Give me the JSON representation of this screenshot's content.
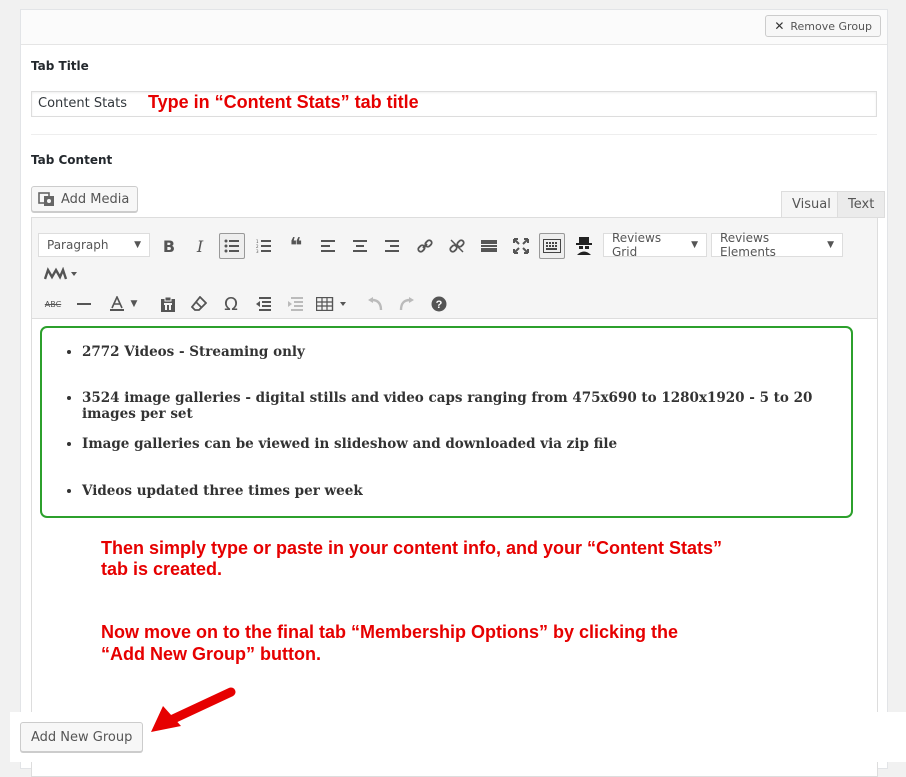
{
  "group": {
    "remove_label": "Remove Group",
    "tab_title_label": "Tab Title",
    "tab_title_value": "Content Stats",
    "tab_content_label": "Tab Content"
  },
  "editor": {
    "add_media_label": "Add Media",
    "tabs": {
      "visual": "Visual",
      "text": "Text"
    },
    "format_select": "Paragraph",
    "reviews_grid": "Reviews Grid",
    "reviews_elements": "Reviews Elements",
    "toolbar_row1_icons": [
      "bold-icon",
      "italic-icon",
      "bullet-list-icon",
      "numbered-list-icon",
      "blockquote-icon",
      "align-left-icon",
      "align-center-icon",
      "align-right-icon",
      "link-icon",
      "unlink-icon",
      "read-more-icon",
      "fullscreen-icon",
      "toolbar-toggle-icon",
      "spy-icon"
    ],
    "toolbar_row2_icons": [
      "strikethrough-icon",
      "horizontal-line-icon",
      "text-color-icon",
      "paste-text-icon",
      "clear-formatting-icon",
      "special-character-icon",
      "outdent-icon",
      "indent-icon",
      "table-icon",
      "undo-icon",
      "redo-icon",
      "help-icon"
    ],
    "content_items": [
      "2772 Videos - Streaming only",
      "3524 image galleries - digital stills and video caps ranging from 475x690 to 1280x1920 - 5 to 20 images per set",
      "Image galleries can be viewed in slideshow and downloaded via zip file",
      "Videos updated three times per week"
    ]
  },
  "annotations": {
    "title_hint": "Type in “Content Stats” tab title",
    "content_hint_line1": "Then simply type or paste in your content info, and your “Content Stats”",
    "content_hint_line2": "tab is created.",
    "next_hint_line1": "Now move on to the final tab “Membership Options” by clicking the",
    "next_hint_line2": "“Add New Group” button."
  },
  "footer": {
    "add_group_label": "Add New Group"
  },
  "colors": {
    "annotation": "#e60000",
    "highlight_box": "#2ca02c",
    "arrow": "#e60000"
  }
}
